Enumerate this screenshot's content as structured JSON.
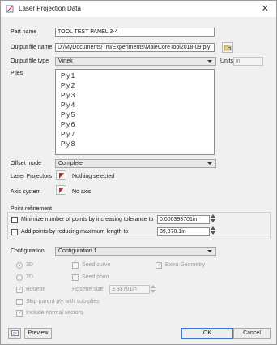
{
  "window": {
    "title": "Laser Projection Data",
    "close_glyph": "✕"
  },
  "part_name": {
    "label": "Part name",
    "value": "TOOL TEST PANEL 3-4"
  },
  "output_file": {
    "label": "Output file name",
    "value": "D:/MyDocuments/Tru/Experiments\\MaleCoreTool2018-09.ply"
  },
  "output_type": {
    "label": "Output file type",
    "value": "Virtek",
    "units_label": "Units",
    "units_value": "in"
  },
  "plies": {
    "label": "Plies",
    "items": [
      "Ply.1",
      "Ply.2",
      "Ply.3",
      "Ply.4",
      "Ply.5",
      "Ply.6",
      "Ply.7",
      "Ply.8"
    ]
  },
  "offset_mode": {
    "label": "Offset mode",
    "value": "Complete"
  },
  "laser_projectors": {
    "label": "Laser Projectors",
    "value": "Nothing selected"
  },
  "axis_system": {
    "label": "Axis system",
    "value": "No axis"
  },
  "point_refinement": {
    "header": "Point refinement",
    "minimize_label": "Minimize number of points by increasing tolerance to",
    "minimize_value": "0.000393701in",
    "add_points_label": "Add points by reducing maximum length to",
    "add_points_value": "39,370.1in"
  },
  "configuration": {
    "label": "Configuration",
    "value": "Configuration.1",
    "options": {
      "r3d": "3D",
      "r2d": "2D",
      "seed_curve": "Seed curve",
      "seed_point": "Seed point",
      "extra_geometry": "Extra Geometry",
      "rosette": "Rosette",
      "rosette_size_label": "Rosette size",
      "rosette_size_value": "3.93701in",
      "skip_parent": "Skip parent ply with sub-plies",
      "include_normal": "Include normal vectors"
    }
  },
  "footer": {
    "preview": "Preview",
    "ok": "OK",
    "cancel": "Cancel"
  },
  "icons": {
    "window": "laser-projection-icon",
    "browse": "browse-folder-icon",
    "picker": "selection-arrow-icon",
    "help": "help-icon"
  },
  "colors": {
    "accent": "#3d7bd4",
    "picker": "#c8242a"
  }
}
